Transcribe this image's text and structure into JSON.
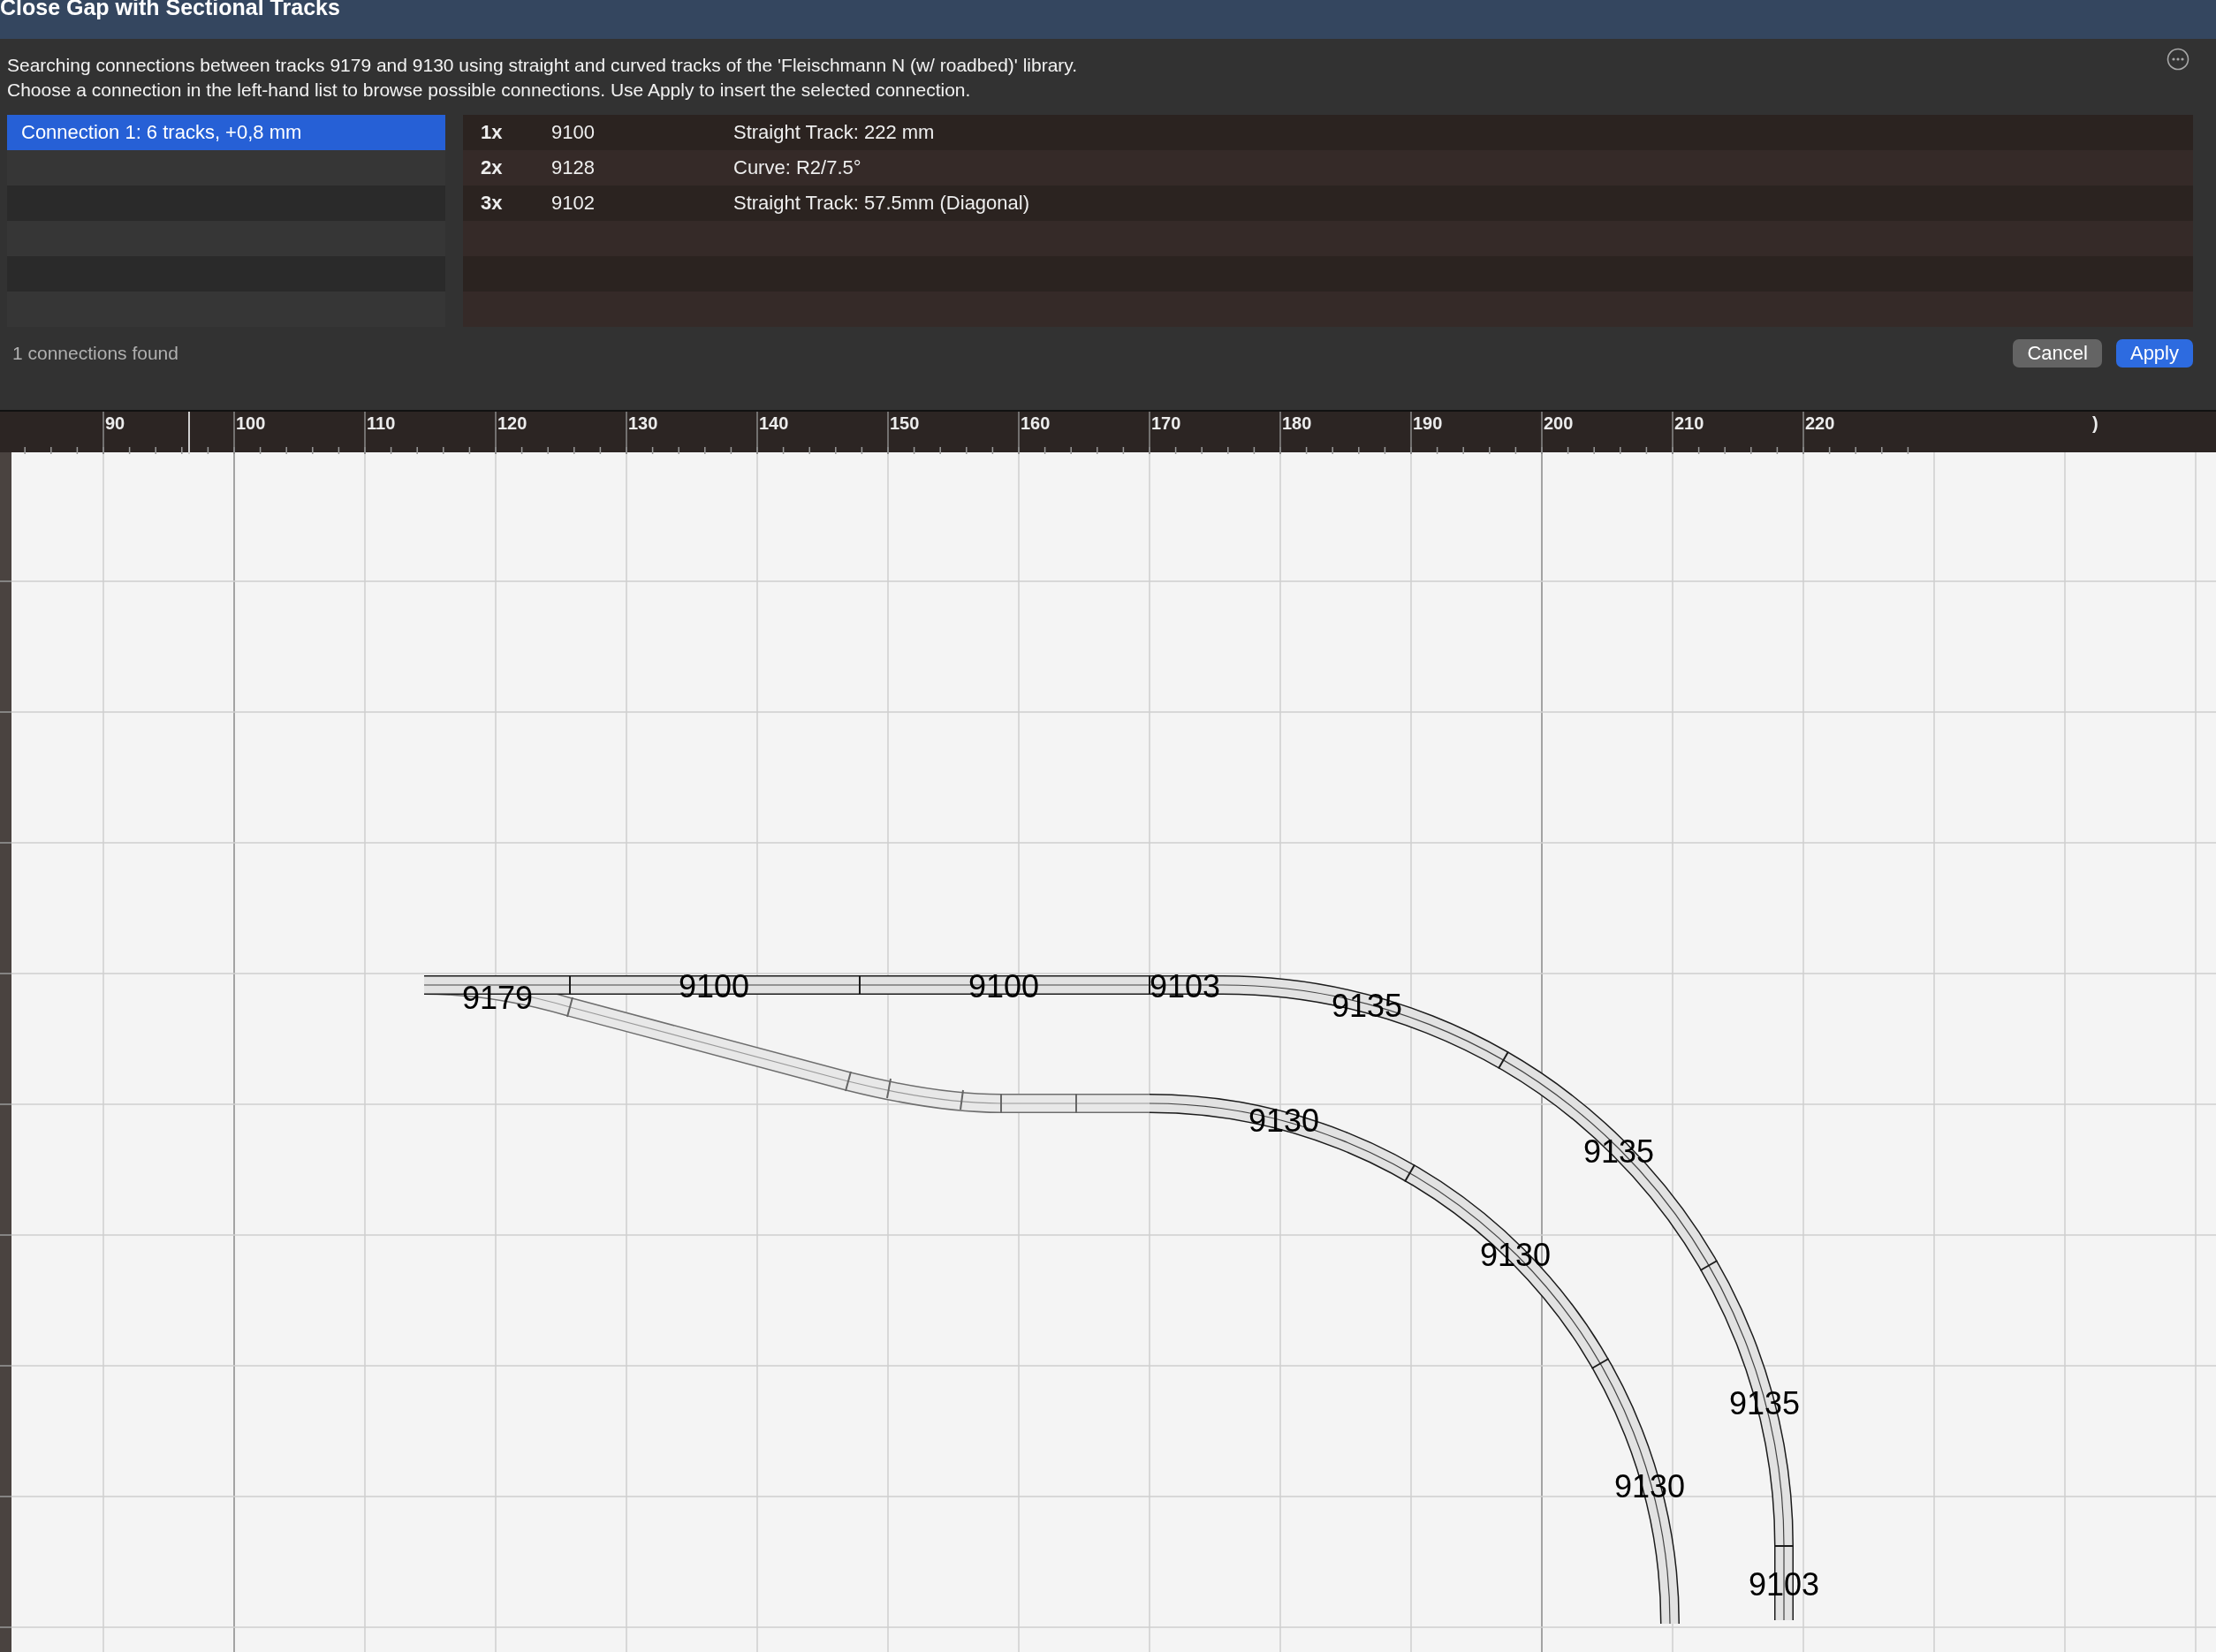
{
  "window": {
    "title": "Close Gap with Sectional Tracks"
  },
  "description": [
    "Searching connections between tracks 9179 and 9130 using straight and curved tracks of the 'Fleischmann N (w/ roadbed)' library.",
    "Choose a connection in the left-hand list to browse possible connections. Use Apply to insert the selected connection."
  ],
  "connections": [
    {
      "label": "Connection 1: 6 tracks, +0,8 mm",
      "selected": true
    }
  ],
  "parts": [
    {
      "count": "1x",
      "number": "9100",
      "description": "Straight Track: 222 mm"
    },
    {
      "count": "2x",
      "number": "9128",
      "description": "Curve: R2/7.5°"
    },
    {
      "count": "3x",
      "number": "9102",
      "description": "Straight Track: 57.5mm (Diagonal)"
    }
  ],
  "status": "1 connections found",
  "buttons": [
    {
      "label": "Cancel",
      "kind": "secondary"
    },
    {
      "label": "Apply",
      "kind": "primary"
    }
  ],
  "ruler": {
    "labels": [
      "90",
      "100",
      "110",
      "120",
      "130",
      "140",
      "150",
      "160",
      "170",
      "180",
      "190",
      "200",
      "210",
      "220"
    ],
    "edge_label": ")"
  },
  "canvas": {
    "labels": [
      "9179",
      "9100",
      "9100",
      "9103",
      "9135",
      "9135",
      "9135",
      "9103",
      "9130",
      "9130",
      "9130"
    ]
  }
}
